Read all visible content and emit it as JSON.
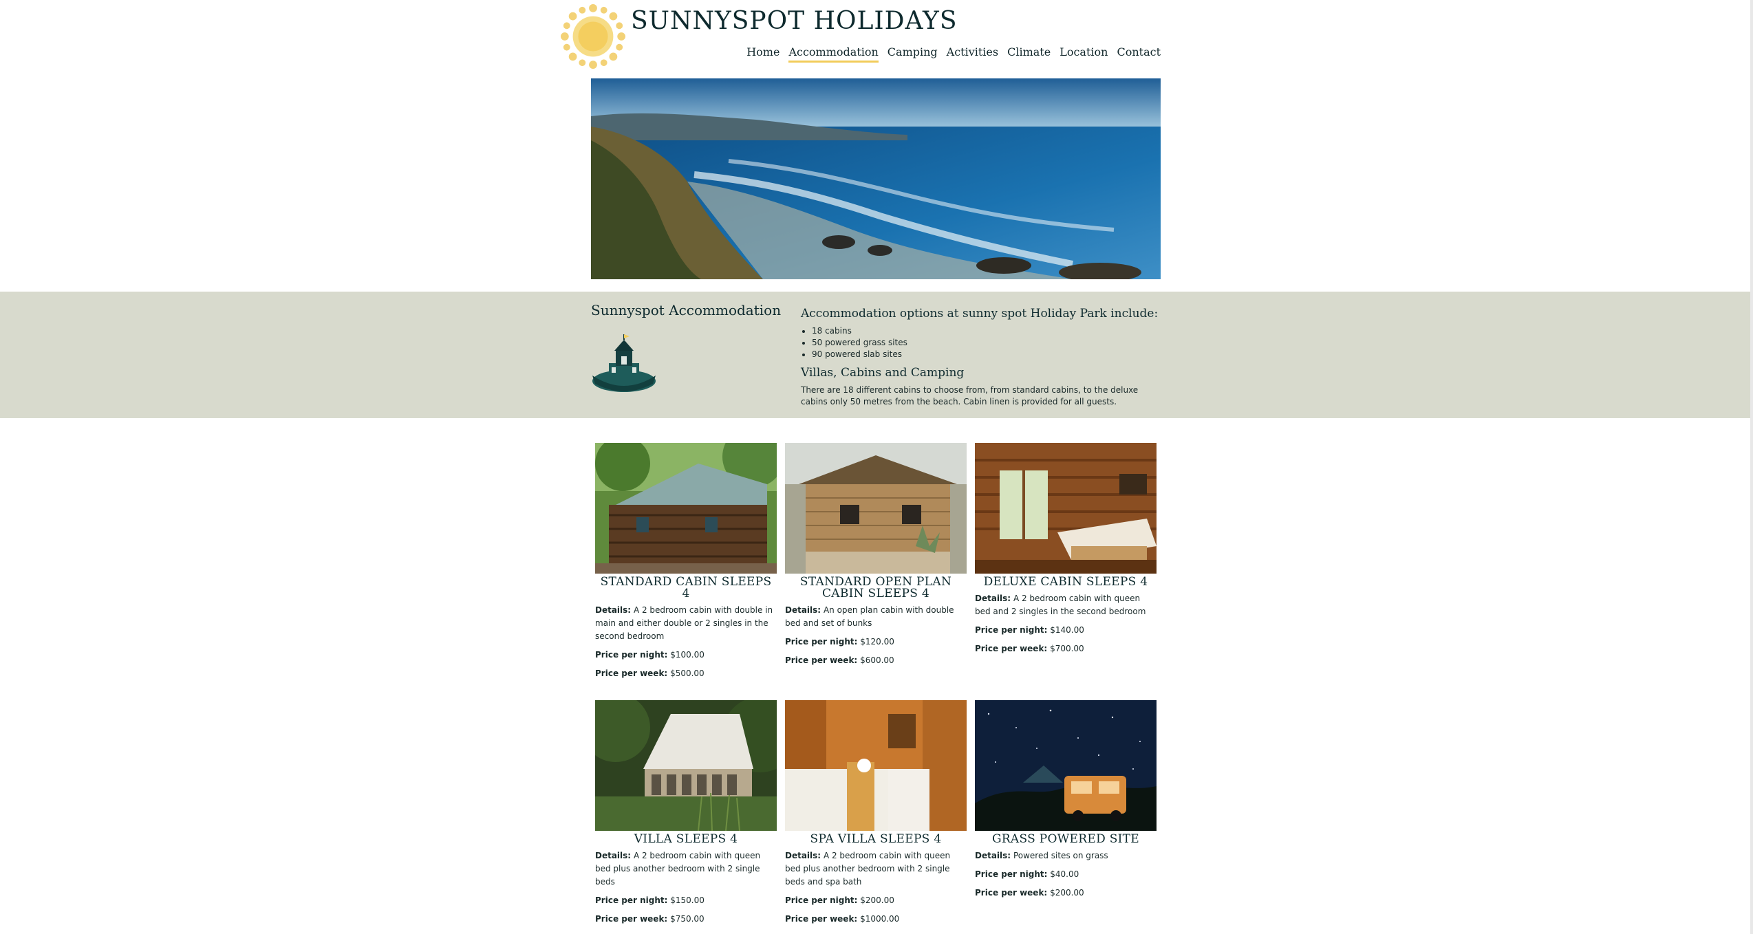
{
  "header": {
    "site_title": "SUNNYSPOT HOLIDAYS",
    "nav": [
      "Home",
      "Accommodation",
      "Camping",
      "Activities",
      "Climate",
      "Location",
      "Contact"
    ],
    "active_nav": "Accommodation"
  },
  "intro": {
    "title": "Sunnyspot Accommodation",
    "options_heading": "Accommodation options at sunny spot Holiday Park include:",
    "options": [
      "18 cabins",
      "50 powered grass sites",
      "90 powered slab sites"
    ],
    "villas_heading": "Villas, Cabins and Camping",
    "villas_text": "There are 18 different cabins to choose from, from standard cabins, to the deluxe cabins only 50 metres from the beach. Cabin linen is provided for all guests."
  },
  "labels": {
    "details": "Details:",
    "price_night": "Price per night:",
    "price_week": "Price per week:"
  },
  "cards": [
    {
      "title": "STANDARD CABIN SLEEPS 4",
      "details": "A 2 bedroom cabin with double in main and either double or 2 singles in the second bedroom",
      "night": "$100.00",
      "week": "$500.00"
    },
    {
      "title": "STANDARD OPEN PLAN CABIN SLEEPS 4",
      "details": "An open plan cabin with double bed and set of bunks",
      "night": "$120.00",
      "week": "$600.00"
    },
    {
      "title": "DELUXE CABIN SLEEPS 4",
      "details": "A 2 bedroom cabin with queen bed and 2 singles in the second bedroom",
      "night": "$140.00",
      "week": "$700.00"
    },
    {
      "title": "VILLA SLEEPS 4",
      "details": "A 2 bedroom cabin with queen bed plus another bedroom with 2 single beds",
      "night": "$150.00",
      "week": "$750.00"
    },
    {
      "title": "SPA VILLA SLEEPS 4",
      "details": "A 2 bedroom cabin with queen bed plus another bedroom with 2 single beds and spa bath",
      "night": "$200.00",
      "week": "$1000.00"
    },
    {
      "title": "GRASS POWERED SITE",
      "details": "Powered sites on grass",
      "night": "$40.00",
      "week": "$200.00"
    }
  ],
  "colors": {
    "band": "#d8dacd",
    "nav_underline": "#f2cc5a",
    "heading": "#0f2b2f"
  }
}
